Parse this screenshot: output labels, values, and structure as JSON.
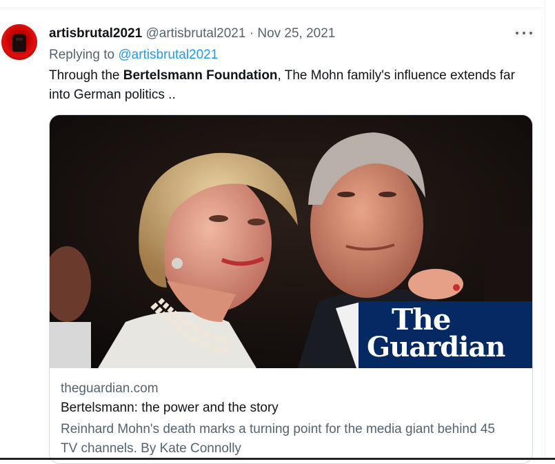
{
  "tweet": {
    "display_name": "artisbrutal2021",
    "handle": "@artisbrutal2021",
    "separator": "·",
    "date": "Nov 25, 2021",
    "reply_prefix": "Replying to",
    "reply_to": "@artisbrutal2021",
    "text_before": "Through the ",
    "text_bold": "Bertelsmann  Foundation",
    "text_after": ", The Mohn family's influence extends far into German politics .."
  },
  "card": {
    "image_logo_line1": "The",
    "image_logo_line2": "Guardian",
    "domain": "theguardian.com",
    "title": "Bertelsmann: the power and the story",
    "description": "Reinhard Mohn's death marks a turning point for the media giant behind 45 TV channels. By Kate Connolly"
  },
  "icons": {
    "avatar": "avatar-icon",
    "more": "more-options-icon"
  },
  "colors": {
    "link": "#1d9bf0",
    "secondary_text": "#536471",
    "guardian_blue": "#052962"
  }
}
